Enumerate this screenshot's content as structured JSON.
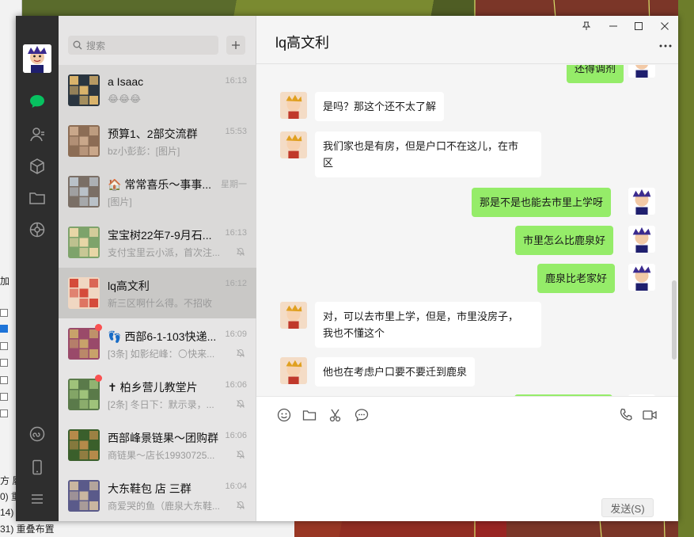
{
  "background": {
    "left_labels": [
      "加",
      "方 屬",
      "0) 重",
      "14) 重",
      "31) 重叠布置"
    ]
  },
  "colors": {
    "nav_bg": "#2e2e2e",
    "list_bg": "#e6e5e5",
    "selected_bg": "#c9c8c6",
    "bubble_out": "#95ec69",
    "bubble_in": "#ffffff",
    "nav_active": "#07c160",
    "unread_dot": "#fa5151"
  },
  "nav": {
    "items": [
      "avatar-icon",
      "chat-icon",
      "contacts-icon",
      "cube-icon",
      "folder-icon",
      "moments-icon",
      "mini-program-icon",
      "phone-icon",
      "menu-icon"
    ]
  },
  "search": {
    "placeholder": "搜索"
  },
  "chats": [
    {
      "name": "a  Isaac",
      "time": "16:13",
      "preview": "😂😂😂",
      "muted": false,
      "unread_dot": false,
      "selected": false
    },
    {
      "name": "预算1、2部交流群",
      "time": "15:53",
      "preview": "bz小彭彭：[图片]",
      "muted": false,
      "unread_dot": false,
      "selected": false
    },
    {
      "name": "🏠 常常喜乐～事事...",
      "time": "星期一",
      "preview": "[图片]",
      "muted": false,
      "unread_dot": false,
      "selected": false
    },
    {
      "name": "宝宝树22年7-9月石...",
      "time": "16:13",
      "preview": "支付宝里云小派，首次注...",
      "muted": true,
      "unread_dot": false,
      "selected": false
    },
    {
      "name": "lq高文利",
      "time": "16:12",
      "preview": "新三区啊什么得。不招收",
      "muted": false,
      "unread_dot": false,
      "selected": true
    },
    {
      "name": "👣 西部6-1-103快递...",
      "time": "16:09",
      "preview": "[3条] 如影纪峰：🌕快来...",
      "muted": true,
      "unread_dot": true,
      "selected": false
    },
    {
      "name": "✝ 柏乡营儿教堂片",
      "time": "16:06",
      "preview": "[2条] 冬日下：默示录，...",
      "muted": true,
      "unread_dot": true,
      "selected": false
    },
    {
      "name": "西部峰景链果～团购群",
      "time": "16:06",
      "preview": "商链果～店长19930725...",
      "muted": true,
      "unread_dot": false,
      "selected": false
    },
    {
      "name": "大东鞋包 店 三群",
      "time": "16:04",
      "preview": "商爱哭的鱼（鹿泉大东鞋...",
      "muted": true,
      "unread_dot": false,
      "selected": false
    }
  ],
  "chat": {
    "title": "lq高文利",
    "messages": [
      {
        "dir": "out",
        "text": "还得调剂"
      },
      {
        "dir": "in",
        "text": "是吗？那这个还不太了解"
      },
      {
        "dir": "in",
        "text": "我们家也是有房，但是户口不在这儿，在市\n区"
      },
      {
        "dir": "out",
        "text": "那是不是也能去市里上学呀"
      },
      {
        "dir": "out",
        "text": "市里怎么比鹿泉好"
      },
      {
        "dir": "out",
        "text": "鹿泉比老家好"
      },
      {
        "dir": "in",
        "text": "对，可以去市里上学，但是，市里没房子，\n我也不懂这个"
      },
      {
        "dir": "in",
        "text": "他也在考虑户口要不要迁到鹿泉"
      },
      {
        "dir": "out",
        "text": ""
      }
    ]
  },
  "composer": {
    "tools": [
      "emoji-icon",
      "folder-icon",
      "scissors-icon",
      "chat-history-icon"
    ],
    "call_tools": [
      "phone-icon",
      "video-icon"
    ],
    "send_label": "发送(S)"
  }
}
